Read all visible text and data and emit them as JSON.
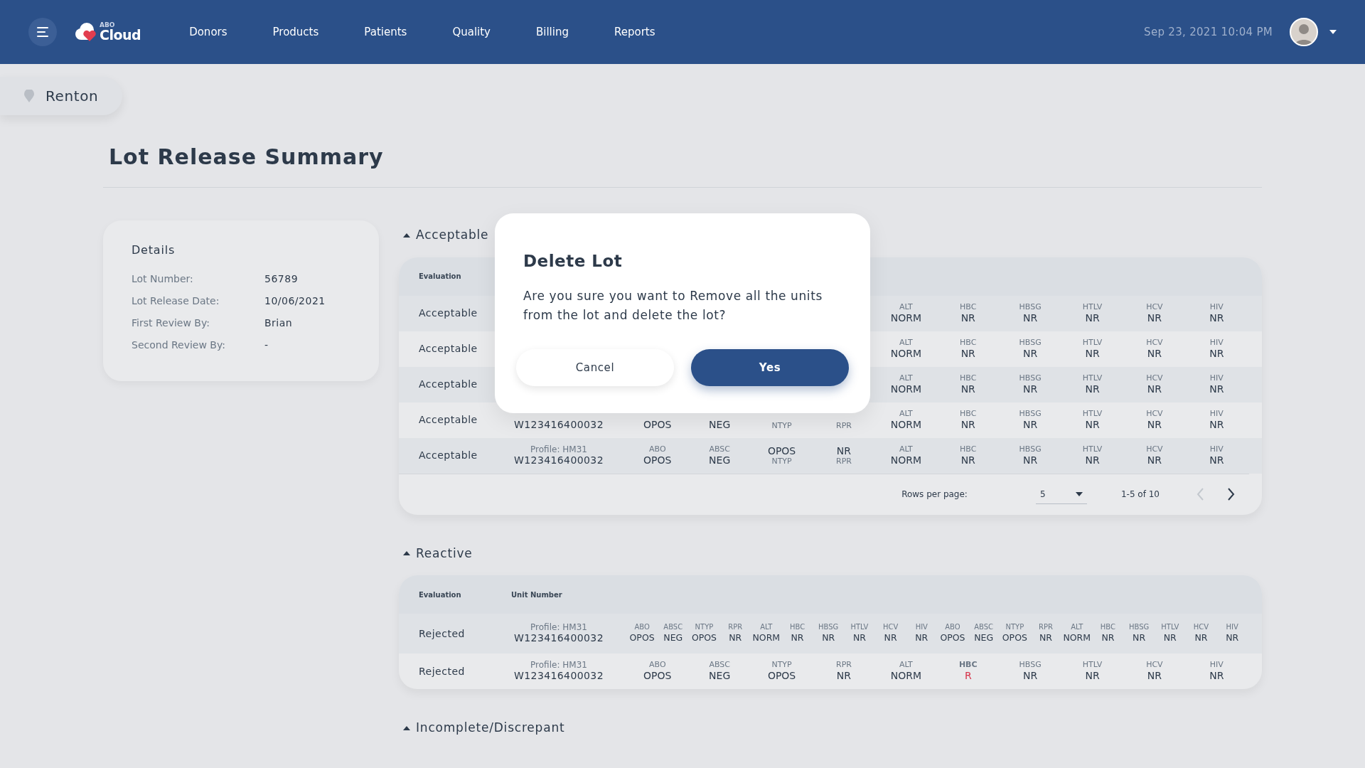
{
  "navbar": {
    "logo": {
      "small": "ABO",
      "name": "Cloud"
    },
    "links": [
      {
        "label": "Donors"
      },
      {
        "label": "Products"
      },
      {
        "label": "Patients"
      },
      {
        "label": "Quality"
      },
      {
        "label": "Billing"
      },
      {
        "label": "Reports"
      }
    ],
    "datetime": "Sep 23, 2021 10:04 PM"
  },
  "location": "Renton",
  "title": "Lot Release Summary",
  "details": {
    "title": "Details",
    "fields": [
      {
        "label": "Lot Number:",
        "value": "56789"
      },
      {
        "label": "Lot Release Date:",
        "value": "10/06/2021"
      },
      {
        "label": "First Review By:",
        "value": "Brian"
      },
      {
        "label": "Second Review By:",
        "value": "-"
      }
    ]
  },
  "sections": [
    {
      "title": "Acceptable",
      "table": {
        "columns": [
          "Evaluation"
        ],
        "rows": [
          {
            "evaluation": "Acceptable",
            "tests": [
              {
                "kind": "label-top",
                "label": "ALT",
                "value": "NORM",
                "abnormal": false
              },
              {
                "kind": "label-top",
                "label": "HBC",
                "value": "NR",
                "abnormal": false
              },
              {
                "kind": "label-top",
                "label": "HBSG",
                "value": "NR",
                "abnormal": false
              },
              {
                "kind": "label-top",
                "label": "HTLV",
                "value": "NR",
                "abnormal": false
              },
              {
                "kind": "label-top",
                "label": "HCV",
                "value": "NR",
                "abnormal": false
              },
              {
                "kind": "label-top",
                "label": "HIV",
                "value": "NR",
                "abnormal": false
              }
            ]
          },
          {
            "evaluation": "Acceptable",
            "tests": [
              {
                "kind": "label-top",
                "label": "ALT",
                "value": "NORM",
                "abnormal": false
              },
              {
                "kind": "label-top",
                "label": "HBC",
                "value": "NR",
                "abnormal": false
              },
              {
                "kind": "label-top",
                "label": "HBSG",
                "value": "NR",
                "abnormal": false
              },
              {
                "kind": "label-top",
                "label": "HTLV",
                "value": "NR",
                "abnormal": false
              },
              {
                "kind": "label-top",
                "label": "HCV",
                "value": "NR",
                "abnormal": false
              },
              {
                "kind": "label-top",
                "label": "HIV",
                "value": "NR",
                "abnormal": false
              }
            ]
          },
          {
            "evaluation": "Acceptable",
            "tests": [
              {
                "kind": "label-top",
                "label": "ALT",
                "value": "NORM",
                "abnormal": false
              },
              {
                "kind": "label-top",
                "label": "HBC",
                "value": "NR",
                "abnormal": false
              },
              {
                "kind": "label-top",
                "label": "HBSG",
                "value": "NR",
                "abnormal": false
              },
              {
                "kind": "label-top",
                "label": "HTLV",
                "value": "NR",
                "abnormal": false
              },
              {
                "kind": "label-top",
                "label": "HCV",
                "value": "NR",
                "abnormal": false
              },
              {
                "kind": "label-top",
                "label": "HIV",
                "value": "NR",
                "abnormal": false
              }
            ]
          },
          {
            "evaluation": "Acceptable",
            "unit": {
              "number": "W123416400032"
            },
            "tests": [
              {
                "kind": "label-top",
                "value": "OPOS",
                "abnormal": false
              },
              {
                "kind": "label-top",
                "value": "NEG",
                "abnormal": false
              },
              {
                "kind": "value-top",
                "label": "NTYP",
                "abnormal": false
              },
              {
                "kind": "value-top",
                "label": "RPR",
                "abnormal": false
              },
              {
                "kind": "label-top",
                "label": "ALT",
                "value": "NORM",
                "abnormal": false
              },
              {
                "kind": "label-top",
                "label": "HBC",
                "value": "NR",
                "abnormal": false
              },
              {
                "kind": "label-top",
                "label": "HBSG",
                "value": "NR",
                "abnormal": false
              },
              {
                "kind": "label-top",
                "label": "HTLV",
                "value": "NR",
                "abnormal": false
              },
              {
                "kind": "label-top",
                "label": "HCV",
                "value": "NR",
                "abnormal": false
              },
              {
                "kind": "label-top",
                "label": "HIV",
                "value": "NR",
                "abnormal": false
              }
            ]
          },
          {
            "evaluation": "Acceptable",
            "unit": {
              "profile": "Profile: HM31",
              "number": "W123416400032"
            },
            "tests": [
              {
                "kind": "label-top",
                "label": "ABO",
                "value": "OPOS",
                "abnormal": false
              },
              {
                "kind": "label-top",
                "label": "ABSC",
                "value": "NEG",
                "abnormal": false
              },
              {
                "kind": "value-top",
                "label": "NTYP",
                "value": "OPOS",
                "abnormal": false
              },
              {
                "kind": "value-top",
                "label": "RPR",
                "value": "NR",
                "abnormal": false
              },
              {
                "kind": "label-top",
                "label": "ALT",
                "value": "NORM",
                "abnormal": false
              },
              {
                "kind": "label-top",
                "label": "HBC",
                "value": "NR",
                "abnormal": false
              },
              {
                "kind": "label-top",
                "label": "HBSG",
                "value": "NR",
                "abnormal": false
              },
              {
                "kind": "label-top",
                "label": "HTLV",
                "value": "NR",
                "abnormal": false
              },
              {
                "kind": "label-top",
                "label": "HCV",
                "value": "NR",
                "abnormal": false
              },
              {
                "kind": "label-top",
                "label": "HIV",
                "value": "NR",
                "abnormal": false
              }
            ]
          }
        ],
        "pagination": {
          "label": "Rows per page:",
          "rows": "5",
          "range": "1-5 of 10",
          "prev_disabled": true,
          "next_disabled": false
        }
      }
    },
    {
      "title": "Reactive",
      "table": {
        "columns": [
          "Evaluation",
          "Unit Number"
        ],
        "rows": [
          {
            "evaluation": "Rejected",
            "unit": {
              "profile": "Profile: HM31",
              "number": "W123416400032"
            },
            "tests": [
              {
                "kind": "label-top",
                "label": "ABO",
                "value": "OPOS",
                "abnormal": false
              },
              {
                "kind": "label-top",
                "label": "ABSC",
                "value": "NEG",
                "abnormal": false
              },
              {
                "kind": "label-top",
                "label": "NTYP",
                "value": "OPOS",
                "abnormal": false
              },
              {
                "kind": "label-top",
                "label": "RPR",
                "value": "NR",
                "abnormal": false
              },
              {
                "kind": "label-top",
                "label": "ALT",
                "value": "NORM",
                "abnormal": false
              },
              {
                "kind": "label-top",
                "label": "HBC",
                "value": "NR",
                "abnormal": false
              },
              {
                "kind": "label-top",
                "label": "HBSG",
                "value": "NR",
                "abnormal": false
              },
              {
                "kind": "label-top",
                "label": "HTLV",
                "value": "NR",
                "abnormal": false
              },
              {
                "kind": "label-top",
                "label": "HCV",
                "value": "NR",
                "abnormal": false
              },
              {
                "kind": "label-top",
                "label": "HIV",
                "value": "NR",
                "abnormal": false
              },
              {
                "kind": "label-top",
                "label": "ABO",
                "value": "OPOS",
                "abnormal": false
              },
              {
                "kind": "label-top",
                "label": "ABSC",
                "value": "NEG",
                "abnormal": false
              },
              {
                "kind": "label-top",
                "label": "NTYP",
                "value": "OPOS",
                "abnormal": false
              },
              {
                "kind": "label-top",
                "label": "RPR",
                "value": "NR",
                "abnormal": false
              },
              {
                "kind": "label-top",
                "label": "ALT",
                "value": "NORM",
                "abnormal": false
              },
              {
                "kind": "label-top",
                "label": "HBC",
                "value": "NR",
                "abnormal": false
              },
              {
                "kind": "label-top",
                "label": "HBSG",
                "value": "NR",
                "abnormal": false
              },
              {
                "kind": "label-top",
                "label": "HTLV",
                "value": "NR",
                "abnormal": false
              },
              {
                "kind": "label-top",
                "label": "HCV",
                "value": "NR",
                "abnormal": false
              },
              {
                "kind": "label-top",
                "label": "HIV",
                "value": "NR",
                "abnormal": false
              }
            ]
          },
          {
            "evaluation": "Rejected",
            "unit": {
              "profile": "Profile: HM31",
              "number": "W123416400032"
            },
            "tests": [
              {
                "kind": "label-top",
                "label": "ABO",
                "value": "OPOS",
                "abnormal": false
              },
              {
                "kind": "label-top",
                "label": "ABSC",
                "value": "NEG",
                "abnormal": false
              },
              {
                "kind": "label-top",
                "label": "NTYP",
                "value": "OPOS",
                "abnormal": false
              },
              {
                "kind": "label-top",
                "label": "RPR",
                "value": "NR",
                "abnormal": false
              },
              {
                "kind": "label-top",
                "label": "ALT",
                "value": "NORM",
                "abnormal": false
              },
              {
                "kind": "label-top",
                "label": "HBC",
                "value": "R",
                "abnormal": true
              },
              {
                "kind": "label-top",
                "label": "HBSG",
                "value": "NR",
                "abnormal": false
              },
              {
                "kind": "label-top",
                "label": "HTLV",
                "value": "NR",
                "abnormal": false
              },
              {
                "kind": "label-top",
                "label": "HCV",
                "value": "NR",
                "abnormal": false
              },
              {
                "kind": "label-top",
                "label": "HIV",
                "value": "NR",
                "abnormal": false
              }
            ]
          }
        ]
      }
    },
    {
      "title": "Incomplete/Discrepant"
    }
  ],
  "dialog": {
    "title": "Delete Lot",
    "message": "Are you sure you want to Remove all the units from the lot and delete the lot?",
    "buttons": [
      {
        "label": "Cancel",
        "kind": "secondary"
      },
      {
        "label": "Yes",
        "kind": "primary"
      }
    ]
  }
}
